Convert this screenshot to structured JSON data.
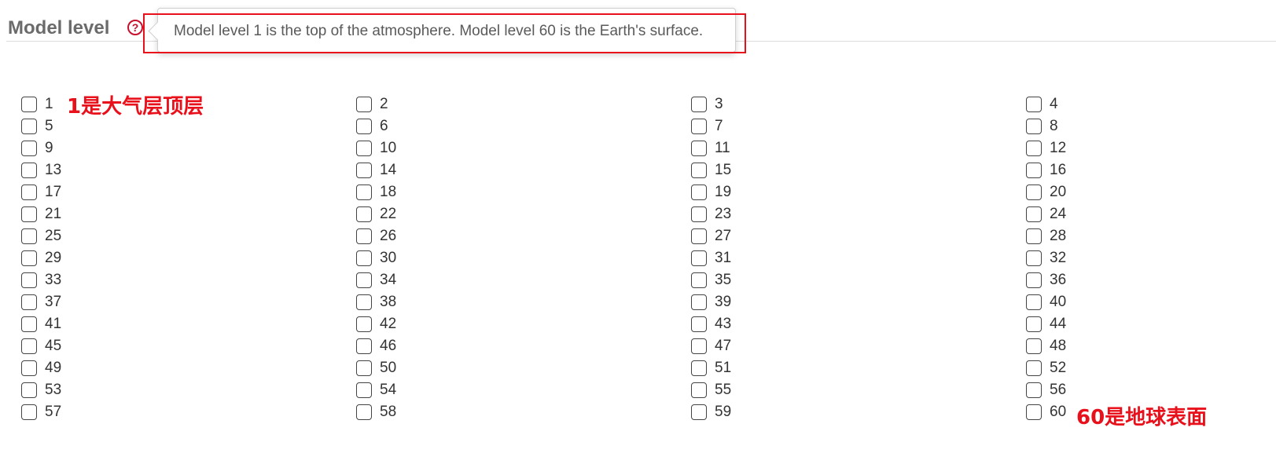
{
  "section": {
    "title": "Model level",
    "help_icon": "question-circle-icon",
    "accent_color": "#c8102e"
  },
  "tooltip": {
    "text": "Model level 1 is the top of the atmosphere. Model level 60 is the Earth's surface."
  },
  "levels": [
    "1",
    "2",
    "3",
    "4",
    "5",
    "6",
    "7",
    "8",
    "9",
    "10",
    "11",
    "12",
    "13",
    "14",
    "15",
    "16",
    "17",
    "18",
    "19",
    "20",
    "21",
    "22",
    "23",
    "24",
    "25",
    "26",
    "27",
    "28",
    "29",
    "30",
    "31",
    "32",
    "33",
    "34",
    "35",
    "36",
    "37",
    "38",
    "39",
    "40",
    "41",
    "42",
    "43",
    "44",
    "45",
    "46",
    "47",
    "48",
    "49",
    "50",
    "51",
    "52",
    "53",
    "54",
    "55",
    "56",
    "57",
    "58",
    "59",
    "60"
  ],
  "annotations": {
    "top": "1是大气层顶层",
    "bottom": "60是地球表面",
    "color": "#e8111b"
  }
}
